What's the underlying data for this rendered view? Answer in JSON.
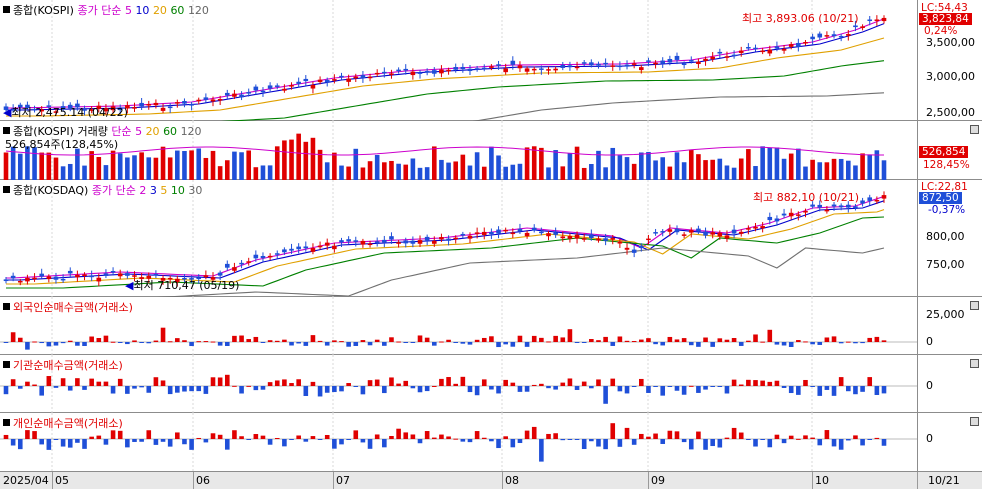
{
  "kospi": {
    "title": "종합(KOSPI)",
    "ma_label": "종가 단순",
    "ma_periods": [
      "5",
      "10",
      "20",
      "60",
      "120"
    ],
    "high_note": "최고 3,893.06 (10/21)",
    "low_note": "최저 2,475.14 (04/22)",
    "axis_labels": [
      "3,500,00",
      "3,000,00",
      "2,500,00"
    ],
    "lc_label": "LC:54,43",
    "price_tag": "3,823,84",
    "change": "0,24%"
  },
  "volume": {
    "title": "종합(KOSPI) 거래량",
    "ma_label": "단순",
    "ma_periods": [
      "5",
      "20",
      "60",
      "120"
    ],
    "current": "526,854주(128,45%)",
    "tag_value": "526,854",
    "tag_pct": "128,45%"
  },
  "kosdaq": {
    "title": "종합(KOSDAQ)",
    "ma_label": "종가 단순",
    "ma_periods": [
      "2",
      "3",
      "5",
      "10",
      "30"
    ],
    "high_note": "최고 882,10 (10/21)",
    "low_note": "최저 710,47 (05/19)",
    "axis_labels": [
      "800,00",
      "750,00"
    ],
    "lc_label": "LC:22,81",
    "price_tag": "872,50",
    "change": "-0,37%"
  },
  "foreign": {
    "title": "외국인순매수금액(거래소)",
    "axis_labels": [
      "25,000",
      "0"
    ]
  },
  "inst": {
    "title": "기관순매수금액(거래소)",
    "axis_labels": [
      "0"
    ]
  },
  "retail": {
    "title": "개인순매수금액(거래소)",
    "axis_labels": [
      "0"
    ]
  },
  "timeline": {
    "labels": [
      "2025/04",
      "05",
      "06",
      "07",
      "08",
      "09",
      "10"
    ],
    "right_label": "10/21"
  },
  "colors": {
    "up": "#e00000",
    "down": "#1f4fd8",
    "ma5": "#cc00cc",
    "ma10": "#0000cc",
    "ma20": "#e0a000",
    "ma60": "#008000",
    "ma120": "#707070"
  }
}
